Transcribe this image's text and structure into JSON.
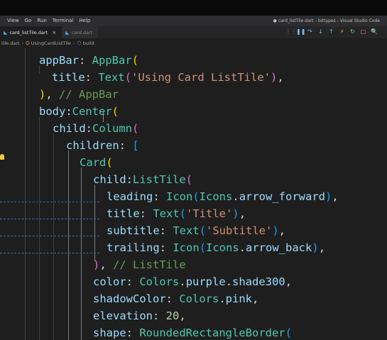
{
  "menubar": {
    "items": [
      "View",
      "Go",
      "Run",
      "Terminal",
      "Help"
    ],
    "window_title": "● card_listTile.dart - listtypes - Visual Studio Code"
  },
  "tabs": [
    {
      "label": "card_listTile.dart",
      "active": true
    },
    {
      "label": "card.dart",
      "active": false
    }
  ],
  "run_toolbar": {
    "buttons": [
      {
        "icon": "drag-handle-icon",
        "glyph": "⋮⋮",
        "color": "#8a8a8a"
      },
      {
        "icon": "pause-icon",
        "glyph": "❚❚",
        "color": "#75beff"
      },
      {
        "icon": "step-over-icon",
        "glyph": "↷",
        "color": "#75beff"
      },
      {
        "icon": "step-into-icon",
        "glyph": "↓",
        "color": "#75beff"
      },
      {
        "icon": "step-out-icon",
        "glyph": "↑",
        "color": "#75beff"
      },
      {
        "icon": "hot-reload-icon",
        "glyph": "⚡",
        "color": "#ffcc00"
      },
      {
        "icon": "restart-icon",
        "glyph": "↻",
        "color": "#89d185"
      },
      {
        "icon": "stop-icon",
        "glyph": "□",
        "color": "#f48771"
      },
      {
        "icon": "devtools-icon",
        "glyph": "🔍",
        "color": "#75beff"
      }
    ]
  },
  "breadcrumb": {
    "file": "tile.dart",
    "class_name": "UsingCardListTile",
    "method": "build"
  },
  "code_lines": [
    [
      [
        "kw-key",
        "appBar"
      ],
      [
        "kw-pun",
        ": "
      ],
      [
        "kw-class",
        "AppBar"
      ],
      [
        "kw-par",
        "("
      ]
    ],
    [
      [
        "kw-key",
        "title"
      ],
      [
        "kw-pun",
        ": "
      ],
      [
        "kw-class",
        "Text"
      ],
      [
        "kw-par2",
        "("
      ],
      [
        "kw-str",
        "'Using Card ListTile'"
      ],
      [
        "kw-par2",
        ")"
      ],
      [
        "kw-pun",
        ","
      ]
    ],
    [
      [
        "kw-par",
        ")"
      ],
      [
        "kw-pun",
        ", "
      ],
      [
        "kw-cmt",
        "// AppBar"
      ]
    ],
    [
      [
        "kw-key",
        "body"
      ],
      [
        "kw-pun",
        ":"
      ],
      [
        "kw-class",
        "Center"
      ],
      [
        "kw-par",
        "("
      ]
    ],
    [
      [
        "kw-key",
        "child"
      ],
      [
        "kw-pun",
        ":"
      ],
      [
        "kw-class",
        "Column"
      ],
      [
        "kw-par2",
        "("
      ]
    ],
    [
      [
        "kw-key",
        "children"
      ],
      [
        "kw-pun",
        ": "
      ],
      [
        "kw-par3",
        "["
      ]
    ],
    [
      [
        "kw-class",
        "Card"
      ],
      [
        "kw-par",
        "("
      ]
    ],
    [
      [
        "kw-key",
        "child"
      ],
      [
        "kw-pun",
        ":"
      ],
      [
        "kw-class",
        "ListTile"
      ],
      [
        "kw-par2",
        "("
      ]
    ],
    [
      [
        "kw-key",
        "leading"
      ],
      [
        "kw-pun",
        ": "
      ],
      [
        "kw-class",
        "Icon"
      ],
      [
        "kw-par3",
        "("
      ],
      [
        "kw-class",
        "Icons"
      ],
      [
        "kw-pun",
        "."
      ],
      [
        "kw-key",
        "arrow_forward"
      ],
      [
        "kw-par3",
        ")"
      ],
      [
        "kw-pun",
        ","
      ]
    ],
    [
      [
        "kw-key",
        "title"
      ],
      [
        "kw-pun",
        ": "
      ],
      [
        "kw-class",
        "Text"
      ],
      [
        "kw-par3",
        "("
      ],
      [
        "kw-str",
        "'Title'"
      ],
      [
        "kw-par3",
        ")"
      ],
      [
        "kw-pun",
        ","
      ]
    ],
    [
      [
        "kw-key",
        "subtitle"
      ],
      [
        "kw-pun",
        ": "
      ],
      [
        "kw-class",
        "Text"
      ],
      [
        "kw-par3",
        "("
      ],
      [
        "kw-str",
        "'Subtitle'"
      ],
      [
        "kw-par3",
        ")"
      ],
      [
        "kw-pun",
        ","
      ]
    ],
    [
      [
        "kw-key",
        "trailing"
      ],
      [
        "kw-pun",
        ": "
      ],
      [
        "kw-class",
        "Icon"
      ],
      [
        "kw-par3",
        "("
      ],
      [
        "kw-class",
        "Icons"
      ],
      [
        "kw-pun",
        "."
      ],
      [
        "kw-key",
        "arrow_back"
      ],
      [
        "kw-par3",
        ")"
      ],
      [
        "kw-pun",
        ","
      ]
    ],
    [
      [
        "kw-par2",
        ")"
      ],
      [
        "kw-pun",
        ", "
      ],
      [
        "kw-cmt",
        "// ListTile"
      ]
    ],
    [
      [
        "kw-key",
        "color"
      ],
      [
        "kw-pun",
        ": "
      ],
      [
        "kw-class",
        "Colors"
      ],
      [
        "kw-pun",
        "."
      ],
      [
        "kw-key",
        "purple"
      ],
      [
        "kw-pun",
        "."
      ],
      [
        "kw-key",
        "shade300"
      ],
      [
        "kw-pun",
        ","
      ]
    ],
    [
      [
        "kw-key",
        "shadowColor"
      ],
      [
        "kw-pun",
        ": "
      ],
      [
        "kw-class",
        "Colors"
      ],
      [
        "kw-pun",
        "."
      ],
      [
        "kw-key",
        "pink"
      ],
      [
        "kw-pun",
        ","
      ]
    ],
    [
      [
        "kw-key",
        "elevation"
      ],
      [
        "kw-pun",
        ": "
      ],
      [
        "kw-num",
        "20"
      ],
      [
        "kw-pun",
        ","
      ]
    ],
    [
      [
        "kw-key",
        "shape"
      ],
      [
        "kw-pun",
        ": "
      ],
      [
        "kw-class",
        "RoundedRectangleBorder"
      ],
      [
        "kw-par3",
        "("
      ]
    ]
  ]
}
